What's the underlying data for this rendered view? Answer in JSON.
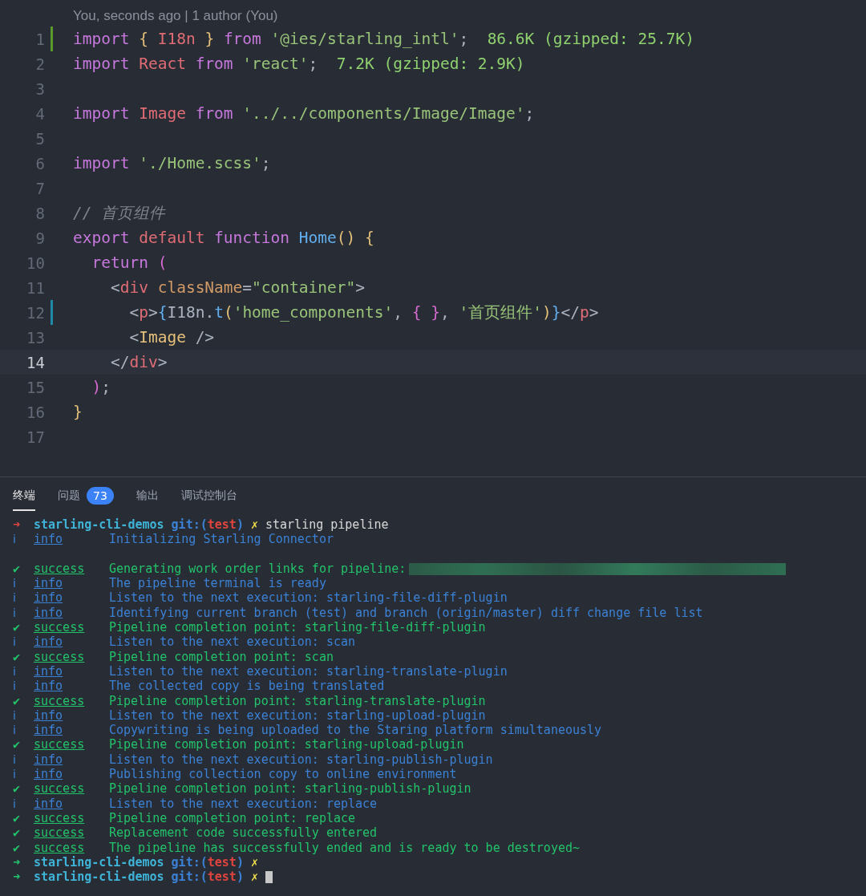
{
  "editor": {
    "blame": "You, seconds ago | 1 author (You)",
    "lines": [
      {
        "number": "1",
        "git_added": true,
        "current": false,
        "tokens": [
          {
            "text": "import ",
            "kind": "kw"
          },
          {
            "text": "{ ",
            "kind": "brace"
          },
          {
            "text": "I18n",
            "kind": "var"
          },
          {
            "text": " } ",
            "kind": "brace"
          },
          {
            "text": "from ",
            "kind": "kw"
          },
          {
            "text": "'@ies/starling_intl'",
            "kind": "str"
          },
          {
            "text": ";  ",
            "kind": "punct"
          },
          {
            "text": "86.6K (gzipped: 25.7K)",
            "kind": "size"
          }
        ]
      },
      {
        "number": "2",
        "current": false,
        "tokens": [
          {
            "text": "import ",
            "kind": "kw"
          },
          {
            "text": "React ",
            "kind": "var"
          },
          {
            "text": "from ",
            "kind": "kw"
          },
          {
            "text": "'react'",
            "kind": "str"
          },
          {
            "text": ";  ",
            "kind": "punct"
          },
          {
            "text": "7.2K (gzipped: 2.9K)",
            "kind": "size"
          }
        ]
      },
      {
        "number": "3",
        "current": false
      },
      {
        "number": "4",
        "current": false,
        "tokens": [
          {
            "text": "import ",
            "kind": "kw"
          },
          {
            "text": "Image ",
            "kind": "var"
          },
          {
            "text": "from ",
            "kind": "kw"
          },
          {
            "text": "'../../components/Image/Image'",
            "kind": "str"
          },
          {
            "text": ";",
            "kind": "punct"
          }
        ]
      },
      {
        "number": "5",
        "current": false
      },
      {
        "number": "6",
        "current": false,
        "tokens": [
          {
            "text": "import ",
            "kind": "kw"
          },
          {
            "text": "'./Home.scss'",
            "kind": "str"
          },
          {
            "text": ";",
            "kind": "punct"
          }
        ]
      },
      {
        "number": "7",
        "current": false
      },
      {
        "number": "8",
        "current": false,
        "tokens": [
          {
            "text": "// 首页组件",
            "kind": "comment"
          }
        ]
      },
      {
        "number": "9",
        "current": false,
        "tokens": [
          {
            "text": "export ",
            "kind": "kw"
          },
          {
            "text": "default ",
            "kind": "var"
          },
          {
            "text": "function ",
            "kind": "kw"
          },
          {
            "text": "Home",
            "kind": "fn"
          },
          {
            "text": "() {",
            "kind": "brace"
          }
        ]
      },
      {
        "number": "10",
        "current": false,
        "tokens": [
          {
            "text": "  return ",
            "kind": "kw"
          },
          {
            "text": "(",
            "kind": "pink"
          }
        ]
      },
      {
        "number": "11",
        "current": false,
        "tokens": [
          {
            "text": "    <",
            "kind": "punct"
          },
          {
            "text": "div ",
            "kind": "var"
          },
          {
            "text": "className",
            "kind": "attr"
          },
          {
            "text": "=",
            "kind": "punct"
          },
          {
            "text": "\"container\"",
            "kind": "str"
          },
          {
            "text": ">",
            "kind": "punct"
          }
        ]
      },
      {
        "number": "12",
        "git_modified": true,
        "current": false,
        "tokens": [
          {
            "text": "      <",
            "kind": "punct"
          },
          {
            "text": "p",
            "kind": "var"
          },
          {
            "text": ">",
            "kind": "punct"
          },
          {
            "text": "{",
            "kind": "fn"
          },
          {
            "text": "I18n.",
            "kind": "punct"
          },
          {
            "text": "t",
            "kind": "fn"
          },
          {
            "text": "(",
            "kind": "brace"
          },
          {
            "text": "'home_components'",
            "kind": "str"
          },
          {
            "text": ", ",
            "kind": "punct"
          },
          {
            "text": "{ }",
            "kind": "pink"
          },
          {
            "text": ", ",
            "kind": "punct"
          },
          {
            "text": "'首页组件'",
            "kind": "str"
          },
          {
            "text": ")",
            "kind": "brace"
          },
          {
            "text": "}",
            "kind": "fn"
          },
          {
            "text": "</",
            "kind": "punct"
          },
          {
            "text": "p",
            "kind": "var"
          },
          {
            "text": ">",
            "kind": "punct"
          }
        ]
      },
      {
        "number": "13",
        "current": false,
        "tokens": [
          {
            "text": "      <",
            "kind": "punct"
          },
          {
            "text": "Image",
            "kind": "brace"
          },
          {
            "text": " />",
            "kind": "punct"
          }
        ]
      },
      {
        "number": "14",
        "current": true,
        "tokens": [
          {
            "text": "    </",
            "kind": "punct"
          },
          {
            "text": "div",
            "kind": "var"
          },
          {
            "text": ">",
            "kind": "punct"
          }
        ]
      },
      {
        "number": "15",
        "current": false,
        "tokens": [
          {
            "text": "  )",
            "kind": "pink"
          },
          {
            "text": ";",
            "kind": "punct"
          }
        ]
      },
      {
        "number": "16",
        "current": false,
        "tokens": [
          {
            "text": "}",
            "kind": "brace"
          }
        ]
      },
      {
        "number": "17",
        "current": false
      }
    ]
  },
  "panel": {
    "tabs": [
      {
        "label": "终端",
        "selected": true
      },
      {
        "label": "问题",
        "selected": false,
        "badge": "73"
      },
      {
        "label": "输出",
        "selected": false
      },
      {
        "label": "调试控制台",
        "selected": false
      }
    ],
    "terminal": [
      {
        "kind": "prompt",
        "failed": true,
        "arrow": "➜",
        "dir": "starling-cli-demos",
        "git": "git:(",
        "branch": "test",
        "close": ")",
        "dirty": "✗",
        "command": "starling pipeline"
      },
      {
        "kind": "info",
        "icon": "ℹ",
        "level": "info",
        "message": "Initializing Starling Connector"
      },
      {
        "kind": "blank"
      },
      {
        "kind": "success",
        "icon": "✔",
        "level": "success",
        "message": "Generating work order links for pipeline:",
        "redacted": true
      },
      {
        "kind": "info",
        "icon": "ℹ",
        "level": "info",
        "message": "The pipeline terminal is ready"
      },
      {
        "kind": "info",
        "icon": "ℹ",
        "level": "info",
        "message": "Listen to the next execution: starling-file-diff-plugin"
      },
      {
        "kind": "info",
        "icon": "ℹ",
        "level": "info",
        "message": "Identifying current branch (test) and branch (origin/master) diff change file list"
      },
      {
        "kind": "success",
        "icon": "✔",
        "level": "success",
        "message": "Pipeline completion point: starling-file-diff-plugin"
      },
      {
        "kind": "info",
        "icon": "ℹ",
        "level": "info",
        "message": "Listen to the next execution: scan"
      },
      {
        "kind": "success",
        "icon": "✔",
        "level": "success",
        "message": "Pipeline completion point: scan"
      },
      {
        "kind": "info",
        "icon": "ℹ",
        "level": "info",
        "message": "Listen to the next execution: starling-translate-plugin"
      },
      {
        "kind": "info",
        "icon": "ℹ",
        "level": "info",
        "message": "The collected copy is being translated"
      },
      {
        "kind": "success",
        "icon": "✔",
        "level": "success",
        "message": "Pipeline completion point: starling-translate-plugin"
      },
      {
        "kind": "info",
        "icon": "ℹ",
        "level": "info",
        "message": "Listen to the next execution: starling-upload-plugin"
      },
      {
        "kind": "info",
        "icon": "ℹ",
        "level": "info",
        "message": "Copywriting is being uploaded to the Staring platform simultaneously"
      },
      {
        "kind": "success",
        "icon": "✔",
        "level": "success",
        "message": "Pipeline completion point: starling-upload-plugin"
      },
      {
        "kind": "info",
        "icon": "ℹ",
        "level": "info",
        "message": "Listen to the next execution: starling-publish-plugin"
      },
      {
        "kind": "info",
        "icon": "ℹ",
        "level": "info",
        "message": "Publishing collection copy to online environment"
      },
      {
        "kind": "success",
        "icon": "✔",
        "level": "success",
        "message": "Pipeline completion point: starling-publish-plugin"
      },
      {
        "kind": "info",
        "icon": "ℹ",
        "level": "info",
        "message": "Listen to the next execution: replace"
      },
      {
        "kind": "success",
        "icon": "✔",
        "level": "success",
        "message": "Pipeline completion point: replace"
      },
      {
        "kind": "success",
        "icon": "✔",
        "level": "success",
        "message": "Replacement code successfully entered"
      },
      {
        "kind": "success",
        "icon": "✔",
        "level": "success",
        "message": "The pipeline has successfully ended and is ready to be destroyed~"
      },
      {
        "kind": "prompt",
        "failed": false,
        "arrow": "➜",
        "dir": "starling-cli-demos",
        "git": "git:(",
        "branch": "test",
        "close": ")",
        "dirty": "✗"
      },
      {
        "kind": "prompt",
        "failed": false,
        "arrow": "➜",
        "dir": "starling-cli-demos",
        "git": "git:(",
        "branch": "test",
        "close": ")",
        "dirty": "✗",
        "cursor": true
      }
    ]
  }
}
